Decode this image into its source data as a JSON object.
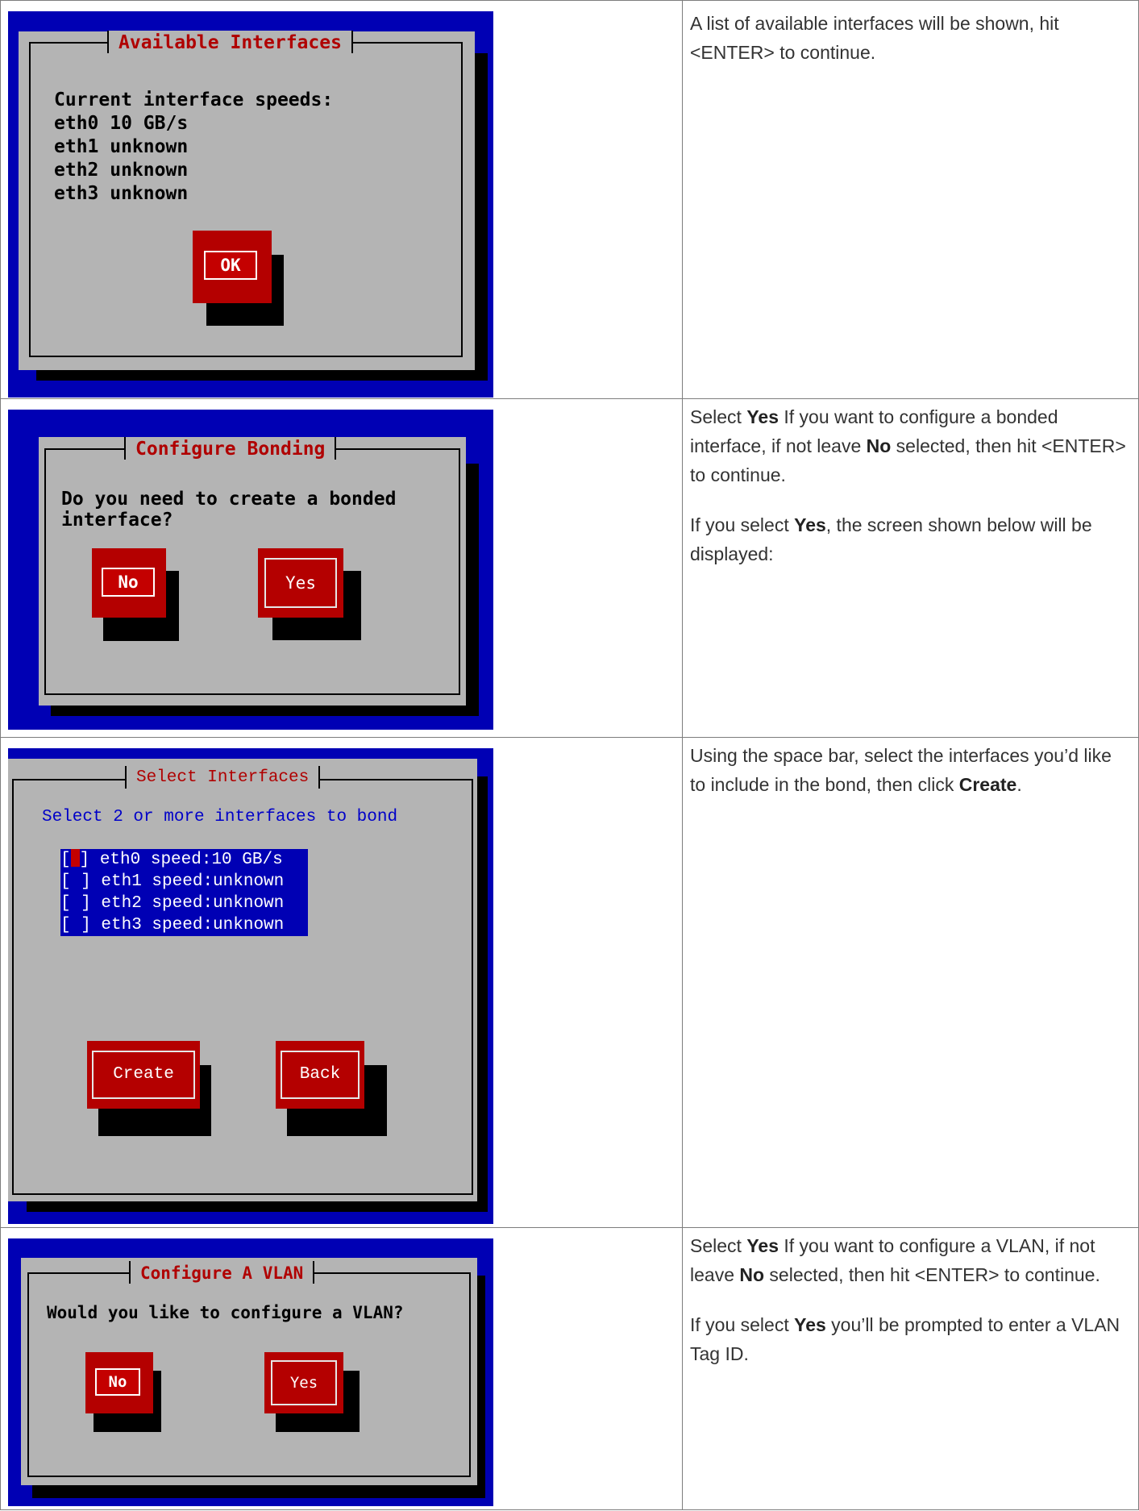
{
  "rows": [
    {
      "dialog": {
        "title": "Available Interfaces",
        "heading": "Current interface speeds:",
        "lines": [
          "eth0 10 GB/s",
          "eth1 unknown",
          "eth2 unknown",
          "eth3 unknown"
        ],
        "ok_label": "OK"
      },
      "description": [
        "A list of available interfaces will be shown, hit <ENTER> to continue."
      ]
    },
    {
      "dialog": {
        "title": "Configure Bonding",
        "question_line1": "Do you need to create a bonded",
        "question_line2": "interface?",
        "no_label": "No",
        "yes_label": "Yes"
      },
      "description": {
        "p1_pre": "Select ",
        "p1_yes": "Yes",
        "p1_mid": " If you want to configure a bonded interface, if not leave ",
        "p1_no": "No",
        "p1_post": " selected, then hit <ENTER> to continue.",
        "p2_pre": "If you select ",
        "p2_yes": "Yes",
        "p2_post": ", the screen shown below will be displayed:"
      }
    },
    {
      "dialog": {
        "title": "Select Interfaces",
        "instruction": "Select 2 or more interfaces to bond",
        "interfaces": [
          {
            "checkbox": "[ ]",
            "label": "eth0 speed:10 GB/s",
            "focused": true
          },
          {
            "checkbox": "[ ]",
            "label": "eth1 speed:unknown",
            "focused": false
          },
          {
            "checkbox": "[ ]",
            "label": "eth2 speed:unknown",
            "focused": false
          },
          {
            "checkbox": "[ ]",
            "label": "eth3 speed:unknown",
            "focused": false
          }
        ],
        "create_label": "Create",
        "back_label": "Back"
      },
      "description": {
        "p1_pre": "Using the space bar, select the interfaces you’d like to include in the bond, then click ",
        "p1_create": "Create",
        "p1_post": "."
      }
    },
    {
      "dialog": {
        "title": "Configure A VLAN",
        "question": "Would you like to configure a VLAN?",
        "no_label": "No",
        "yes_label": "Yes"
      },
      "description": {
        "p1_pre": "Select ",
        "p1_yes": "Yes",
        "p1_mid": " If you want to configure a VLAN, if not leave ",
        "p1_no": "No",
        "p1_post": " selected, then hit <ENTER> to continue.",
        "p2_pre": "If you select ",
        "p2_yes": "Yes",
        "p2_post": " you’ll be prompted to enter a VLAN Tag ID."
      }
    }
  ],
  "colors": {
    "terminal_bg": "#0000b4",
    "dialog_bg": "#b4b4b4",
    "title_red": "#b00000",
    "button_red": "#b40000"
  }
}
